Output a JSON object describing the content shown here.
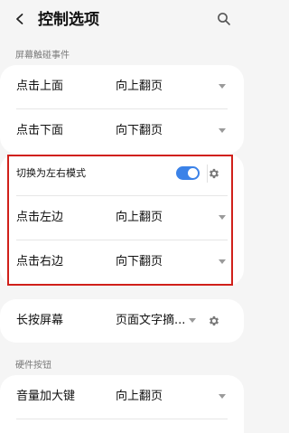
{
  "header": {
    "title": "控制选项"
  },
  "touch_section": {
    "header": "屏幕触碰事件",
    "top_rows": [
      {
        "label": "点击上面",
        "value": "向上翻页"
      },
      {
        "label": "点击下面",
        "value": "向下翻页"
      }
    ],
    "toggle": {
      "label": "切换为左右模式",
      "on": true
    },
    "lr_rows": [
      {
        "label": "点击左边",
        "value": "向上翻页"
      },
      {
        "label": "点击右边",
        "value": "向下翻页"
      }
    ]
  },
  "long_press": {
    "label": "长按屏幕",
    "value": "页面文字摘..."
  },
  "hardware_section": {
    "header": "硬件按钮",
    "rows": [
      {
        "label": "音量加大键",
        "value": "向上翻页"
      }
    ]
  },
  "colors": {
    "accent": "#3b82e8",
    "highlight_border": "#d0201a",
    "background": "#f5f5f5",
    "card": "#ffffff"
  },
  "icons": {
    "back": "back-arrow-icon",
    "search": "search-icon",
    "dropdown": "chevron-down-icon",
    "settings": "gear-icon"
  }
}
